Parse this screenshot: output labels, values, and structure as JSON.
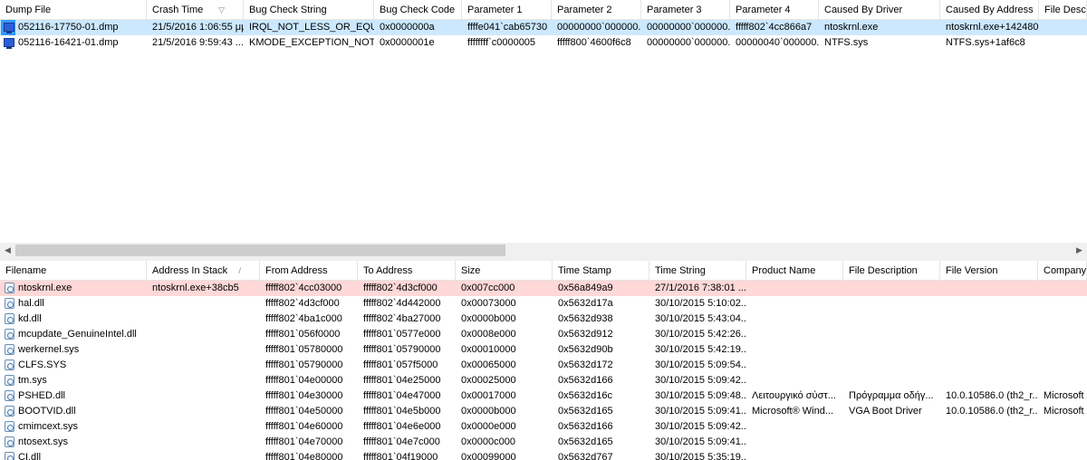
{
  "top_table": {
    "columns": [
      "Dump File",
      "Crash Time",
      "Bug Check String",
      "Bug Check Code",
      "Parameter 1",
      "Parameter 2",
      "Parameter 3",
      "Parameter 4",
      "Caused By Driver",
      "Caused By Address",
      "File Descri"
    ],
    "sort_indicator": "▽",
    "rows": [
      [
        "052116-17750-01.dmp",
        "21/5/2016 1:06:55 μμ",
        "IRQL_NOT_LESS_OR_EQUAL",
        "0x0000000a",
        "ffffe041`cab65730",
        "00000000`000000...",
        "00000000`000000...",
        "fffff802`4cc866a7",
        "ntoskrnl.exe",
        "ntoskrnl.exe+142480",
        ""
      ],
      [
        "052116-16421-01.dmp",
        "21/5/2016 9:59:43 ...",
        "KMODE_EXCEPTION_NOT...",
        "0x0000001e",
        "ffffffff`c0000005",
        "fffff800`4600f6c8",
        "00000000`000000...",
        "00000040`000000...",
        "NTFS.sys",
        "NTFS.sys+1af6c8",
        ""
      ]
    ]
  },
  "scrollbar": {
    "left_arrow": "◀",
    "right_arrow": "▶"
  },
  "bottom_table": {
    "columns": [
      "Filename",
      "Address In Stack",
      "From Address",
      "To Address",
      "Size",
      "Time Stamp",
      "Time String",
      "Product Name",
      "File Description",
      "File Version",
      "Company"
    ],
    "sort_indicator": "/",
    "rows": [
      [
        "ntoskrnl.exe",
        "ntoskrnl.exe+38cb5",
        "fffff802`4cc03000",
        "fffff802`4d3cf000",
        "0x007cc000",
        "0x56a849a9",
        "27/1/2016 7:38:01 ...",
        "",
        "",
        "",
        ""
      ],
      [
        "hal.dll",
        "",
        "fffff802`4d3cf000",
        "fffff802`4d442000",
        "0x00073000",
        "0x5632d17a",
        "30/10/2015 5:10:02...",
        "",
        "",
        "",
        ""
      ],
      [
        "kd.dll",
        "",
        "fffff802`4ba1c000",
        "fffff802`4ba27000",
        "0x0000b000",
        "0x5632d938",
        "30/10/2015 5:43:04...",
        "",
        "",
        "",
        ""
      ],
      [
        "mcupdate_GenuineIntel.dll",
        "",
        "fffff801`056f0000",
        "fffff801`0577e000",
        "0x0008e000",
        "0x5632d912",
        "30/10/2015 5:42:26...",
        "",
        "",
        "",
        ""
      ],
      [
        "werkernel.sys",
        "",
        "fffff801`05780000",
        "fffff801`05790000",
        "0x00010000",
        "0x5632d90b",
        "30/10/2015 5:42:19...",
        "",
        "",
        "",
        ""
      ],
      [
        "CLFS.SYS",
        "",
        "fffff801`05790000",
        "fffff801`057f5000",
        "0x00065000",
        "0x5632d172",
        "30/10/2015 5:09:54...",
        "",
        "",
        "",
        ""
      ],
      [
        "tm.sys",
        "",
        "fffff801`04e00000",
        "fffff801`04e25000",
        "0x00025000",
        "0x5632d166",
        "30/10/2015 5:09:42...",
        "",
        "",
        "",
        ""
      ],
      [
        "PSHED.dll",
        "",
        "fffff801`04e30000",
        "fffff801`04e47000",
        "0x00017000",
        "0x5632d16c",
        "30/10/2015 5:09:48...",
        "Λειτουργικό σύστ...",
        "Πρόγραμμα οδήγ...",
        "10.0.10586.0 (th2_r...",
        "Microsoft"
      ],
      [
        "BOOTVID.dll",
        "",
        "fffff801`04e50000",
        "fffff801`04e5b000",
        "0x0000b000",
        "0x5632d165",
        "30/10/2015 5:09:41...",
        "Microsoft® Wind...",
        "VGA Boot Driver",
        "10.0.10586.0 (th2_r...",
        "Microsoft"
      ],
      [
        "cmimcext.sys",
        "",
        "fffff801`04e60000",
        "fffff801`04e6e000",
        "0x0000e000",
        "0x5632d166",
        "30/10/2015 5:09:42...",
        "",
        "",
        "",
        ""
      ],
      [
        "ntosext.sys",
        "",
        "fffff801`04e70000",
        "fffff801`04e7c000",
        "0x0000c000",
        "0x5632d165",
        "30/10/2015 5:09:41...",
        "",
        "",
        "",
        ""
      ],
      [
        "CI.dll",
        "",
        "fffff801`04e80000",
        "fffff801`04f19000",
        "0x00099000",
        "0x5632d767",
        "30/10/2015 5:35:19...",
        "",
        "",
        "",
        ""
      ]
    ]
  },
  "colors": {
    "selected_row": "#cce8ff",
    "highlight_row": "#ffd8d8",
    "selection_marker": "#3399ff"
  }
}
